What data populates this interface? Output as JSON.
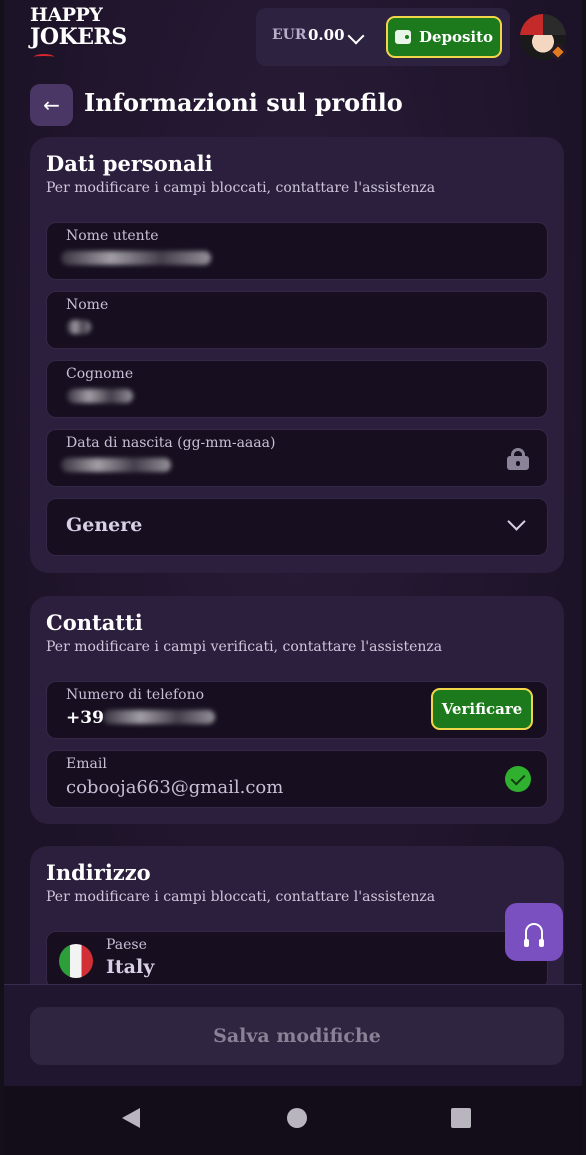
{
  "header": {
    "logo_line1": "HAPPY",
    "logo_line2": "JOKERS",
    "currency": "EUR",
    "balance": "0.00",
    "deposit_label": "Deposito"
  },
  "page": {
    "title": "Informazioni sul profilo"
  },
  "personal": {
    "title": "Dati personali",
    "subtitle": "Per modificare i campi bloccati, contattare l'assistenza",
    "username_label": "Nome utente",
    "firstname_label": "Nome",
    "lastname_label": "Cognome",
    "birthdate_label": "Data di nascita (gg-mm-aaaa)",
    "gender_label": "Genere"
  },
  "contacts": {
    "title": "Contatti",
    "subtitle": "Per modificare i campi verificati, contattare l'assistenza",
    "phone_label": "Numero di telefono",
    "phone_prefix": "+39",
    "verify_label": "Verificare",
    "email_label": "Email",
    "email_value": "cobooja663@gmail.com"
  },
  "address": {
    "title": "Indirizzo",
    "subtitle": "Per modificare i campi bloccati, contattare l'assistenza",
    "country_label": "Paese",
    "country_value": "Italy"
  },
  "footer": {
    "save_label": "Salva modifiche"
  },
  "colors": {
    "accent_green": "#1c7a1c",
    "accent_gold": "#f2d64a",
    "support_purple": "#7a4fc0"
  }
}
